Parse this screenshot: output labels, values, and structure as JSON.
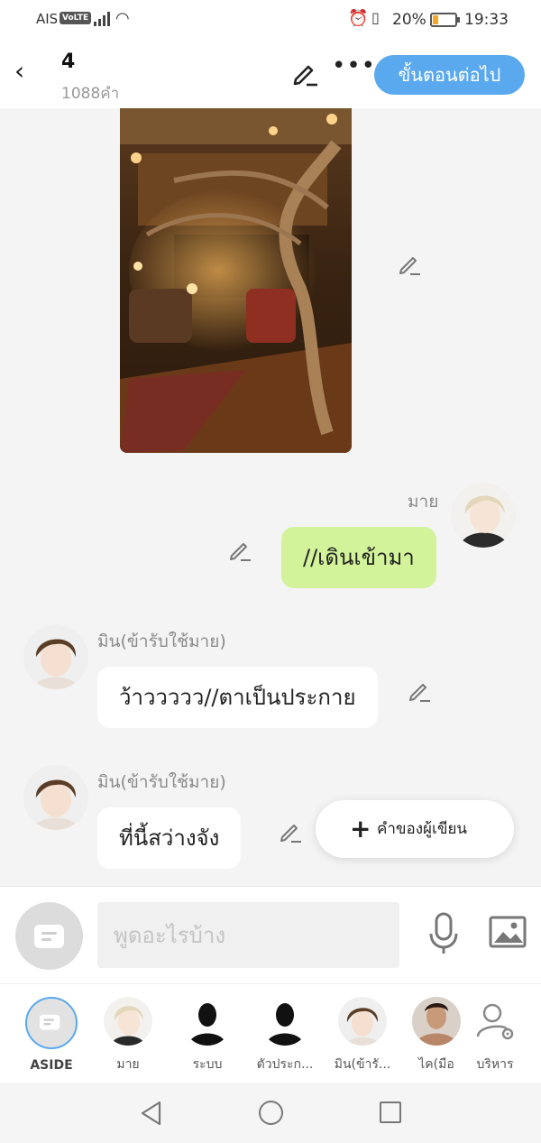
{
  "status_bar": {
    "carrier": "AIS",
    "volte": "VoLTE",
    "battery_percent": "20%",
    "time": "19:33",
    "battery_color": "#f5a623"
  },
  "header": {
    "chapter_title": "4",
    "word_count": "1088คำ",
    "next_button": "ขั้นตอนต่อไป",
    "accent_color": "#5aa9ef"
  },
  "messages": [
    {
      "speaker": "มาย",
      "text": "//เดินเข้ามา",
      "side": "right",
      "bubble_color": "#d2f39a"
    },
    {
      "speaker": "มิน(ข้ารับใช้มาย)",
      "text": "ว้าววววว//ตาเป็นประกาย",
      "side": "left",
      "bubble_color": "#ffffff"
    },
    {
      "speaker": "มิน(ข้ารับใช้มาย)",
      "text": "ที่นี้สว่างจัง",
      "side": "left",
      "bubble_color": "#ffffff"
    }
  ],
  "author_note_button": "คำของผู้เขียน",
  "input": {
    "placeholder": "พูดอะไรบ้าง"
  },
  "characters": [
    {
      "name": "ASIDE"
    },
    {
      "name": "มาย"
    },
    {
      "name": "ระบบ"
    },
    {
      "name": "ตัวประก..."
    },
    {
      "name": "มิน(ข้ารั..."
    },
    {
      "name": "ไค(มือ"
    },
    {
      "name": "บริหาร"
    }
  ]
}
